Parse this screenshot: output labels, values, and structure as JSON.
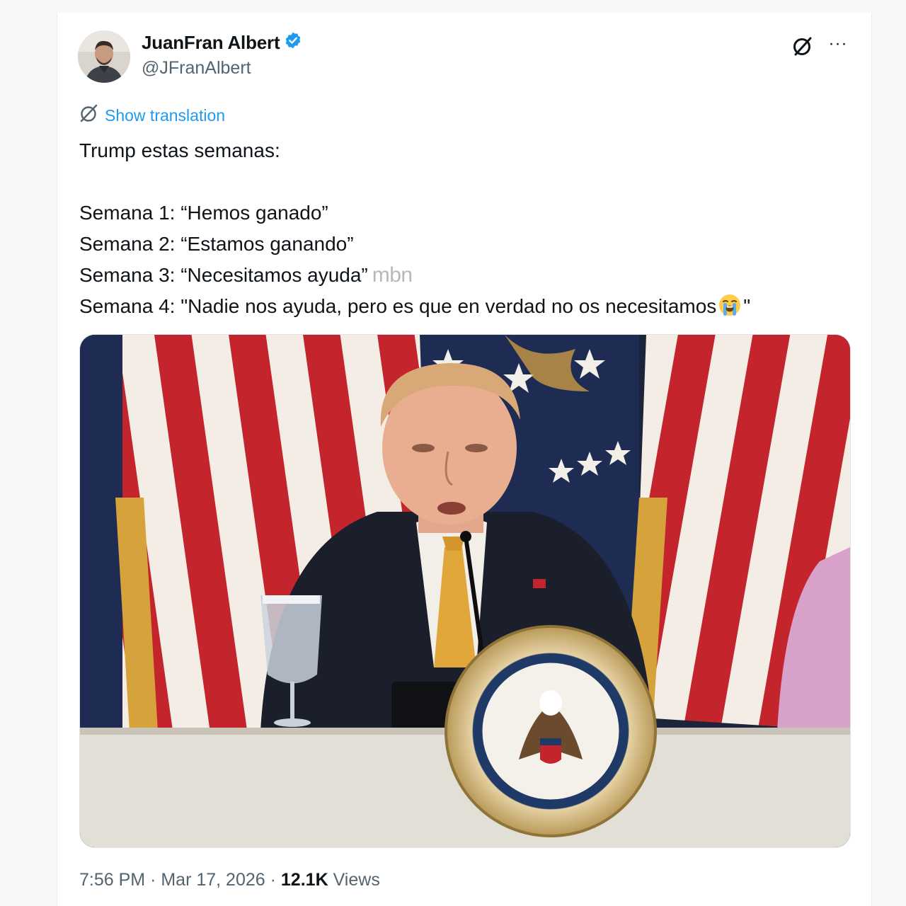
{
  "author": {
    "name": "JuanFran Albert",
    "handle": "@JFranAlbert",
    "verified": true,
    "verified_color": "#1d9bf0"
  },
  "actions": {
    "grok_icon": "grok-icon",
    "more_label": "···"
  },
  "translation": {
    "label": "Show translation",
    "icon": "globe-slash-icon"
  },
  "tweet": {
    "intro": "Trump estas semanas:",
    "lines": [
      "Semana 1: “Hemos ganado”",
      "Semana 2: “Estamos ganando”",
      "Semana 3: “Necesitamos ayuda”",
      "Semana 4: \"Nadie nos ayuda, pero es que en verdad no os necesitamos"
    ],
    "line4_end": "\"",
    "emoji": "😭",
    "watermark": "mbn"
  },
  "media": {
    "icon": "tweet-photo"
  },
  "meta": {
    "time": "7:56 PM",
    "separator": "·",
    "date": "Mar 17, 2026",
    "views_count": "12.1K",
    "views_label": "Views"
  },
  "colors": {
    "accent": "#1d9bf0",
    "secondary_text": "#536471",
    "primary_text": "#0f1419"
  }
}
